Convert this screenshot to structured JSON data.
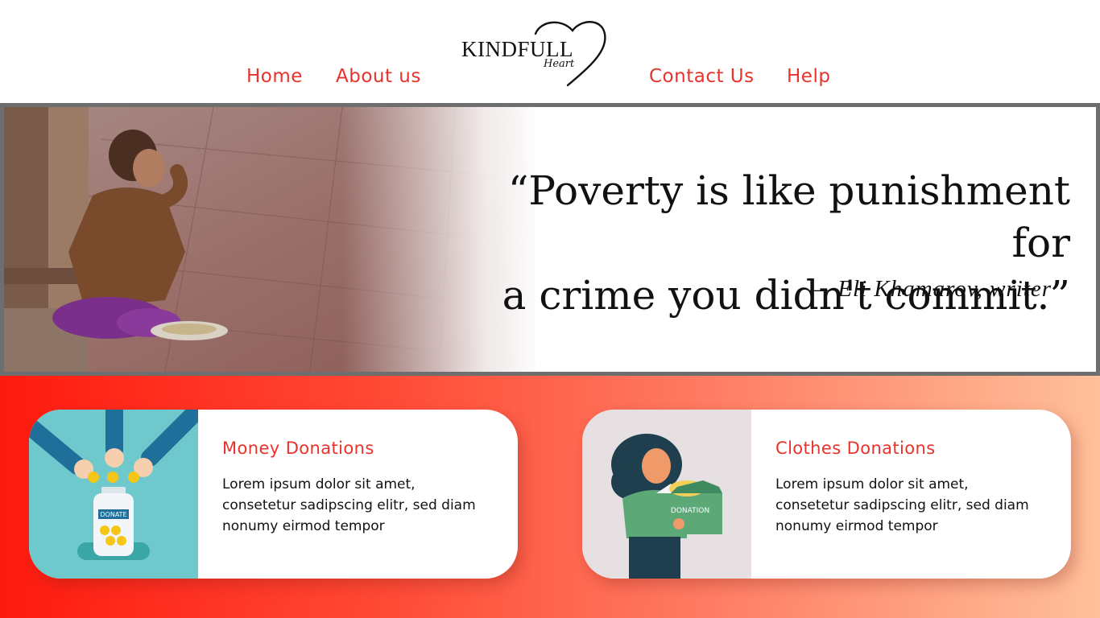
{
  "nav": {
    "home": "Home",
    "about": "About us",
    "contact": "Contact Us",
    "help": "Help"
  },
  "logo": {
    "name": "KINDFULL",
    "sub": "Heart"
  },
  "hero": {
    "quote_line1": "“Poverty is like punishment for",
    "quote_line2": "a crime you didn't commit.”",
    "author": "— Eli Khamarov, writer"
  },
  "cards": [
    {
      "title": "Money Donations",
      "text": "Lorem ipsum dolor sit amet, consetetur sadipscing elitr, sed diam nonumy eirmod tempor",
      "badge": "DONATE"
    },
    {
      "title": "Clothes Donations",
      "text": "Lorem ipsum dolor sit amet, consetetur sadipscing elitr, sed diam nonumy eirmod tempor",
      "badge": "DONATION"
    }
  ],
  "colors": {
    "accent": "#e8322c",
    "band_start": "#ff1a0f",
    "band_end": "#ffc09a",
    "hero_border": "#6e6e6e"
  }
}
